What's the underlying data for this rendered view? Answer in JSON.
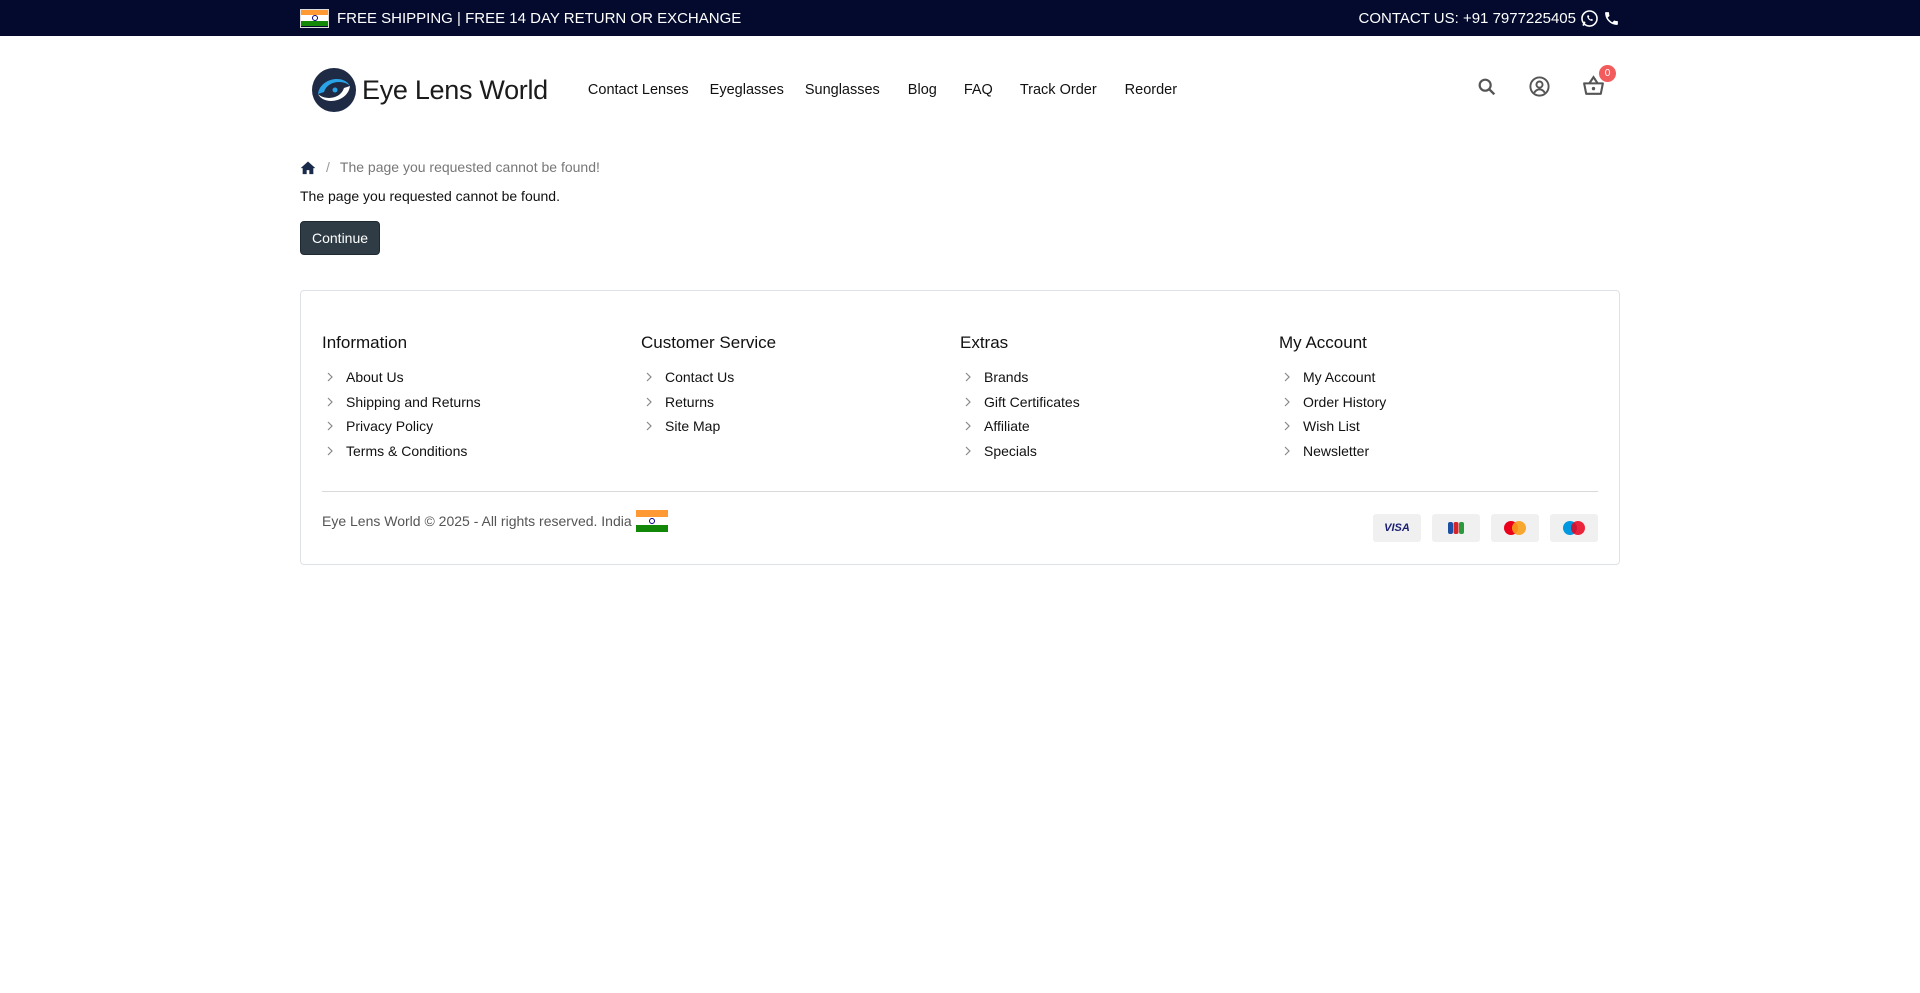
{
  "topbar": {
    "shipping_text": "FREE SHIPPING | FREE 14 DAY RETURN OR EXCHANGE",
    "contact_text": "CONTACT US: +91 7977225405"
  },
  "header": {
    "logo_text": "Eye Lens World",
    "nav": [
      "Contact Lenses",
      "Eyeglasses",
      "Sunglasses",
      "Blog",
      "FAQ",
      "Track Order",
      "Reorder"
    ],
    "cart_count": "0"
  },
  "breadcrumb": {
    "current": "The page you requested cannot be found!"
  },
  "main": {
    "message": "The page you requested cannot be found.",
    "continue_label": "Continue"
  },
  "footer": {
    "columns": [
      {
        "title": "Information",
        "links": [
          "About Us",
          "Shipping and Returns",
          "Privacy Policy",
          "Terms & Conditions"
        ]
      },
      {
        "title": "Customer Service",
        "links": [
          "Contact Us",
          "Returns",
          "Site Map"
        ]
      },
      {
        "title": "Extras",
        "links": [
          "Brands",
          "Gift Certificates",
          "Affiliate",
          "Specials"
        ]
      },
      {
        "title": "My Account",
        "links": [
          "My Account",
          "Order History",
          "Wish List",
          "Newsletter"
        ]
      }
    ],
    "copyright": "Eye Lens World © 2025 - All rights reserved. India",
    "payments": {
      "visa": "VISA"
    }
  },
  "colors": {
    "topbar_bg": "#030a2d",
    "button_bg": "#2f3c45",
    "badge_bg": "#f25c5c"
  },
  "icons": [
    "india-flag-icon",
    "whatsapp-icon",
    "phone-icon",
    "search-icon",
    "user-icon",
    "cart-icon",
    "home-icon",
    "chevron-right-icon"
  ]
}
